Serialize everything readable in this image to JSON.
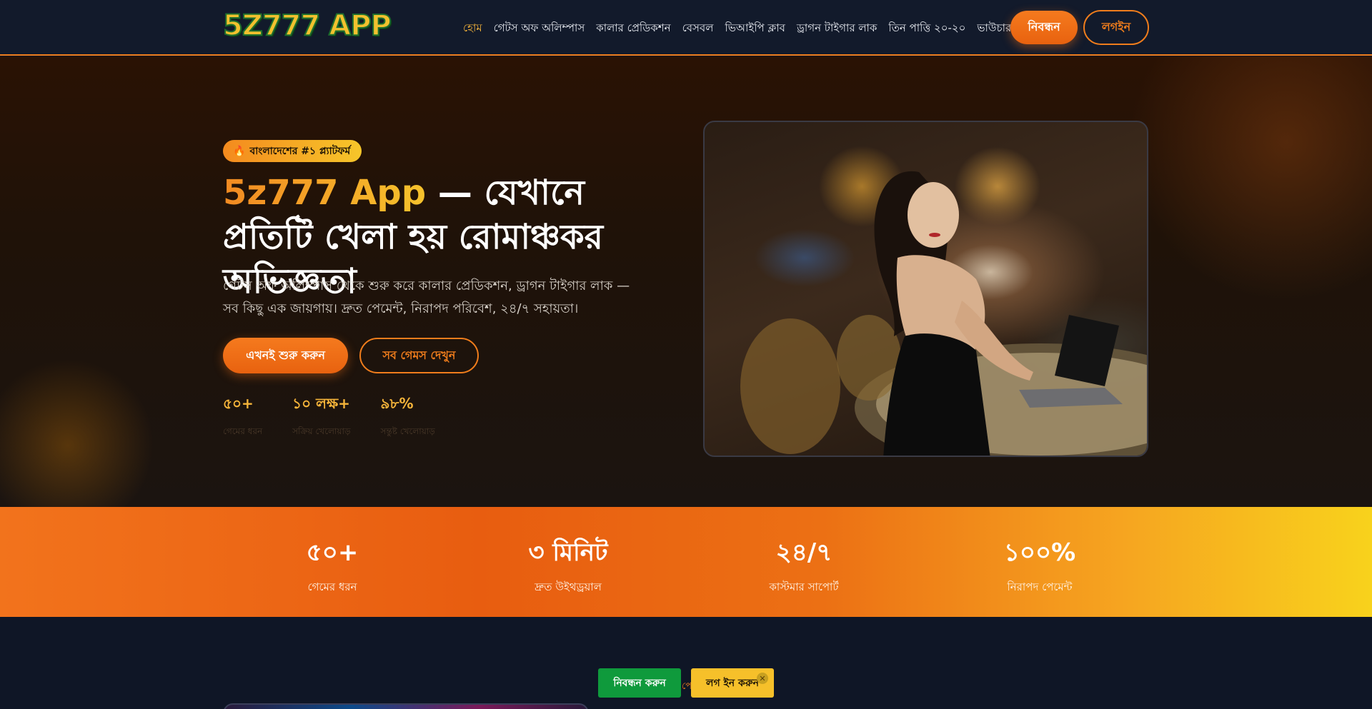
{
  "header": {
    "logo": "5Z777 APP",
    "nav": [
      {
        "label": "হোম",
        "active": true
      },
      {
        "label": "গেটস অফ অলিম্পাস"
      },
      {
        "label": "কালার প্রেডিকশন"
      },
      {
        "label": "বেসবল"
      },
      {
        "label": "ভিআইপি ক্লাব"
      },
      {
        "label": "ড্রাগন টাইগার লাক"
      },
      {
        "label": "তিন পাত্তি ২০-২০"
      },
      {
        "label": "ভাউচার"
      }
    ],
    "register_label": "নিবন্ধন",
    "login_label": "লগইন"
  },
  "hero": {
    "badge_icon": "fire-icon",
    "badge": "বাংলাদেশের #১ প্ল্যাটফর্ম",
    "title_brand": "5z777 App",
    "title_rest": " — যেখানে প্রতিটি খেলা হয় রোমাঞ্চকর অভিজ্ঞতা",
    "description": "গেটস অফ অলিম্পাস থেকে শুরু করে কালার প্রেডিকশন, ড্রাগন টাইগার লাক — সব কিছু এক জায়গায়। দ্রুত পেমেন্ট, নিরাপদ পরিবেশ, ২৪/৭ সহায়তা।",
    "start_button": "এখনই শুরু করুন",
    "games_button": "সব গেমস দেখুন",
    "mini_stats": [
      {
        "value": "৫০+",
        "label": "গেমের ধরন"
      },
      {
        "value": "১০ লক্ষ+",
        "label": "সক্রিয় খেলোয়াড়"
      },
      {
        "value": "৯৮%",
        "label": "সন্তুষ্ট খেলোয়াড়"
      }
    ]
  },
  "stats_band": [
    {
      "value": "৫০+",
      "label": "গেমের ধরন"
    },
    {
      "value": "৩ মিনিট",
      "label": "দ্রুত উইথড্রয়াল"
    },
    {
      "value": "২৪/৭",
      "label": "কাস্টমার সাপোর্ট"
    },
    {
      "value": "১০০%",
      "label": "নিরাপদ পেমেন্ট"
    }
  ],
  "sticky_bar": {
    "register": "নিবন্ধন করুন",
    "login": "লগ ইন করুন",
    "close": "✕",
    "peek": "পে"
  },
  "colors": {
    "accent": "#f07d1c",
    "gold": "#f5b43a",
    "dark_bg": "#0f1626",
    "green": "#0f9a3c"
  }
}
